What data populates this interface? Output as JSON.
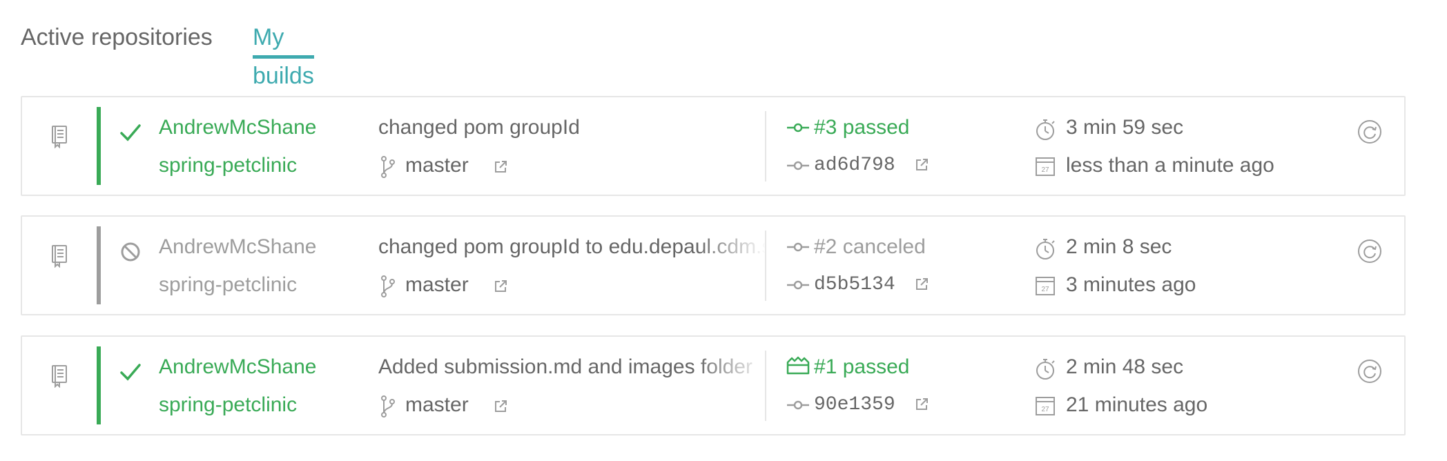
{
  "tabs": {
    "active_repositories": "Active repositories",
    "my_builds": "My builds"
  },
  "colors": {
    "accent": "#3eaaaf",
    "passed": "#39aa56",
    "canceled": "#9d9d9d",
    "text": "#666666",
    "border": "#e6e6e6"
  },
  "builds": [
    {
      "status": "passed",
      "state_icon": "check-icon",
      "owner": "AndrewMcShane",
      "repo": "spring-petclinic",
      "message": "changed pom groupId",
      "branch": "master",
      "build_label": "#3 passed",
      "build_icon": "commit-icon",
      "sha": "ad6d798",
      "duration": "3 min 59 sec",
      "finished": "less than a minute ago"
    },
    {
      "status": "canceled",
      "state_icon": "canceled-icon",
      "owner": "AndrewMcShane",
      "repo": "spring-petclinic",
      "message": "changed pom groupId to edu.depaul.cdm.se",
      "branch": "master",
      "build_label": "#2 canceled",
      "build_icon": "commit-icon",
      "sha": "d5b5134",
      "duration": "2 min 8 sec",
      "finished": "3 minutes ago"
    },
    {
      "status": "passed",
      "state_icon": "check-icon",
      "owner": "AndrewMcShane",
      "repo": "spring-petclinic",
      "message": "Added submission.md and images folder",
      "branch": "master",
      "build_label": "#1 passed",
      "build_icon": "push-icon",
      "sha": "90e1359",
      "duration": "2 min 48 sec",
      "finished": "21 minutes ago"
    }
  ]
}
